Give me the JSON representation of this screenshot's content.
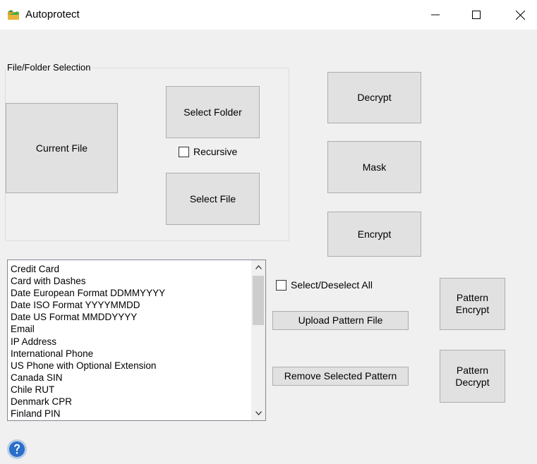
{
  "window": {
    "title": "Autoprotect",
    "icon": "folder-app-icon"
  },
  "file_selection": {
    "group_label": "File/Folder Selection",
    "current_file_label": "Current File",
    "select_folder_label": "Select Folder",
    "recursive_label": "Recursive",
    "recursive_checked": false,
    "select_file_label": "Select File"
  },
  "actions": {
    "decrypt_label": "Decrypt",
    "mask_label": "Mask",
    "encrypt_label": "Encrypt"
  },
  "patterns": {
    "items": [
      "Credit Card",
      "Card with Dashes",
      "Date European Format DDMMYYYY",
      "Date ISO Format YYYYMMDD",
      "Date US Format MMDDYYYY",
      "Email",
      "IP Address",
      "International Phone",
      "US Phone with Optional Extension",
      "Canada SIN",
      "Chile RUT",
      "Denmark CPR",
      "Finland PIN"
    ],
    "select_all_label": "Select/Deselect All",
    "select_all_checked": false,
    "upload_label": "Upload Pattern File",
    "remove_label": "Remove Selected Pattern",
    "pattern_encrypt_label": "Pattern\nEncrypt",
    "pattern_decrypt_label": "Pattern\nDecrypt"
  },
  "colors": {
    "window_bg": "#f0f0f0",
    "button_bg": "#e1e1e1",
    "help_icon": "#2a6fc9"
  }
}
